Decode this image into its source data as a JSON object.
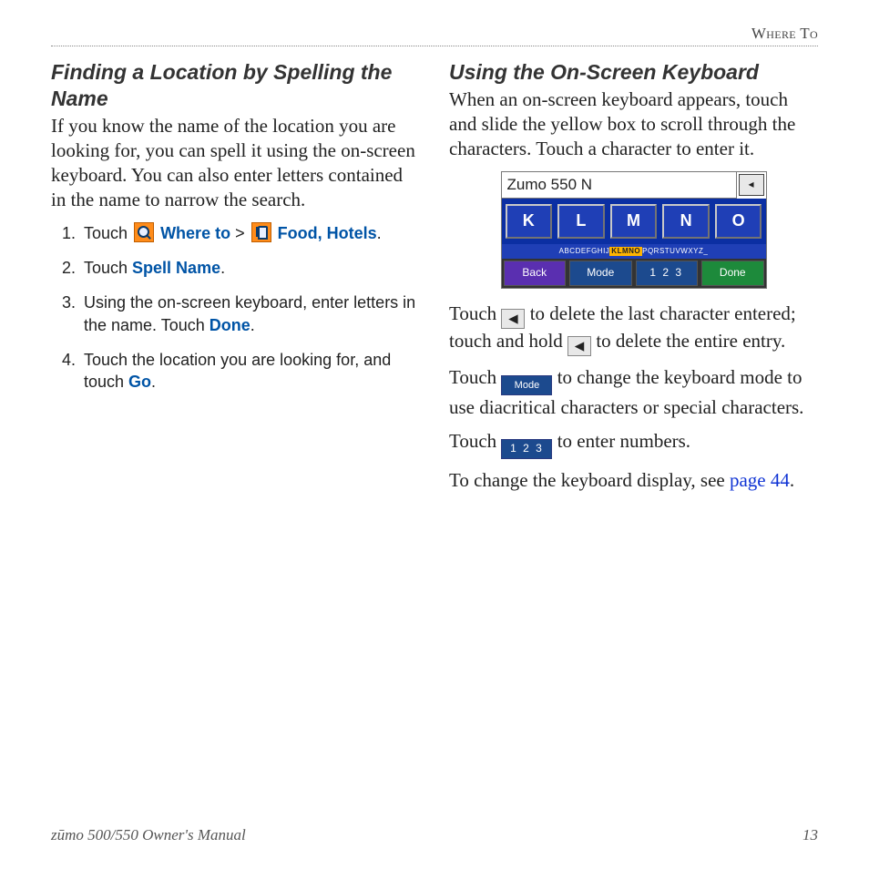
{
  "runningHead": "Where To",
  "left": {
    "title": "Finding a Location by Spelling the Name",
    "intro": "If you know the name of the location you are looking for, you can spell it using the on-screen keyboard. You can also enter letters contained in the name to narrow the search.",
    "steps": {
      "s1a": "Touch ",
      "s1_whereto": "Where to",
      "s1_gt": " > ",
      "s1_food": "Food, Hotels",
      "s1_end": ".",
      "s2a": "Touch ",
      "s2_spell": "Spell Name",
      "s2_end": ".",
      "s3a": "Using the on-screen keyboard, enter letters in the name. Touch ",
      "s3_done": "Done",
      "s3_end": ".",
      "s4a": "Touch the location you are looking for, and touch ",
      "s4_go": "Go",
      "s4_end": "."
    }
  },
  "right": {
    "title": "Using the On-Screen Keyboard",
    "intro": "When an on-screen keyboard appears, touch and slide the yellow box to scroll through the characters. Touch a character to enter it.",
    "entry": "Zumo 550 N",
    "keys": [
      "K",
      "L",
      "M",
      "N",
      "O"
    ],
    "stripL": "ABCDEFGHIJ",
    "stripM": "KLMNO",
    "stripR": "PQRSTUVWXYZ_",
    "bottom": {
      "back": "Back",
      "mode": "Mode",
      "num": "1 2 3",
      "done": "Done"
    },
    "p_del1": "Touch ",
    "p_del2": " to delete the last character entered; touch and hold ",
    "p_del3": " to delete the entire entry.",
    "p_mode1": "Touch ",
    "p_mode2": " to change the keyboard mode to use diacritical characters or special characters.",
    "p_num1": "Touch ",
    "p_num2": " to enter numbers.",
    "p_disp1": "To change the keyboard display, see ",
    "p_disp_link": "page 44",
    "p_disp2": "."
  },
  "footer": {
    "left": "zūmo 500/550 Owner's Manual",
    "right": "13"
  },
  "inline": {
    "arrow": "◂",
    "mode": "Mode",
    "num": "1 2 3"
  }
}
